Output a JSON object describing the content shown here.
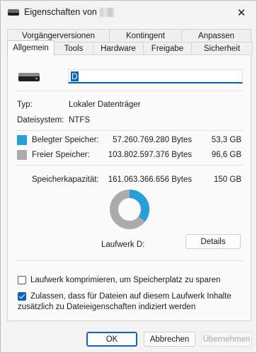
{
  "window": {
    "title": "Eigenschaften von",
    "close_glyph": "✕"
  },
  "tabs": {
    "row1": [
      "Vorgängerversionen",
      "Kontingent",
      "Anpassen"
    ],
    "row2": [
      "Allgemein",
      "Tools",
      "Hardware",
      "Freigabe",
      "Sicherheit"
    ],
    "active": "Allgemein"
  },
  "general": {
    "drive_name": "D",
    "type_label": "Typ:",
    "type_value": "Lokaler Datenträger",
    "fs_label": "Dateisystem:",
    "fs_value": "NTFS",
    "used_label": "Belegter Speicher:",
    "used_bytes": "57.260.769.280 Bytes",
    "used_gb": "53,3 GB",
    "free_label": "Freier Speicher:",
    "free_bytes": "103.802.597.376 Bytes",
    "free_gb": "96,6 GB",
    "capacity_label": "Speicherkapazität:",
    "capacity_bytes": "161.063.366.656 Bytes",
    "capacity_gb": "150 GB",
    "drive_label": "Laufwerk D:",
    "details_button": "Details",
    "used_fraction": 0.3555,
    "used_color": "#26a0da",
    "free_color": "#ababab"
  },
  "options": {
    "compress_label": "Laufwerk komprimieren, um Speicherplatz zu sparen",
    "compress_checked": false,
    "index_label_line1": "Zulassen, dass für Dateien auf diesem Laufwerk Inhalte",
    "index_label_line2": "zusätzlich zu Dateieigenschaften indiziert werden",
    "index_checked": true
  },
  "footer": {
    "ok": "OK",
    "cancel": "Abbrechen",
    "apply": "Übernehmen"
  },
  "icons": {
    "title": "drive-icon",
    "close": "close-icon",
    "drive": "hard-drive-icon",
    "checkmark": "checkmark-icon"
  }
}
